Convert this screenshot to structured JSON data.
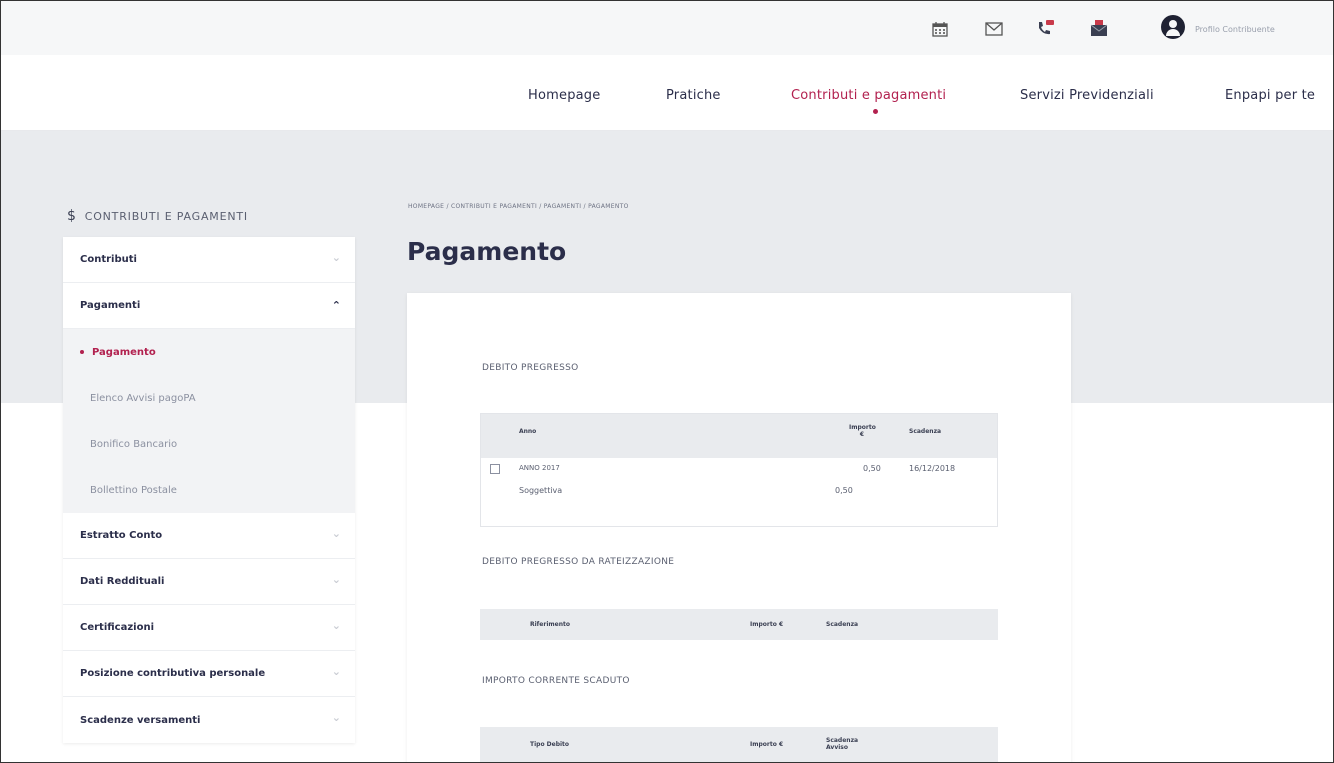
{
  "topbar": {
    "icons": [
      "calendar-icon",
      "mail-icon",
      "phone-icon",
      "inbox-icon"
    ],
    "user_name": "Profilo Contribuente"
  },
  "nav": {
    "items": [
      {
        "label": "Homepage"
      },
      {
        "label": "Pratiche"
      },
      {
        "label": "Contributi e pagamenti",
        "active": true
      },
      {
        "label": "Servizi Previdenziali"
      },
      {
        "label": "Enpapi per te"
      }
    ]
  },
  "sidebar": {
    "title": "CONTRIBUTI E PAGAMENTI",
    "items": [
      {
        "label": "Contributi"
      },
      {
        "label": "Pagamenti",
        "open": true
      },
      {
        "label": "Estratto Conto"
      },
      {
        "label": "Dati Reddituali"
      },
      {
        "label": "Certificazioni"
      },
      {
        "label": "Posizione contributiva personale"
      },
      {
        "label": "Scadenze versamenti"
      }
    ],
    "subitems": [
      {
        "label": "Pagamento",
        "active": true
      },
      {
        "label": "Elenco Avvisi pagoPA"
      },
      {
        "label": "Bonifico Bancario"
      },
      {
        "label": "Bollettino Postale"
      }
    ]
  },
  "breadcrumb": "HOMEPAGE / CONTRIBUTI E PAGAMENTI / PAGAMENTI / PAGAMENTO",
  "page_title": "Pagamento",
  "sections": {
    "debito": {
      "title": "DEBITO PREGRESSO",
      "headers": {
        "anno": "Anno",
        "importo": "Importo €",
        "scadenza": "Scadenza"
      },
      "row": {
        "anno": "ANNO 2017",
        "importo": "0,50",
        "scadenza": "16/12/2018"
      },
      "subrow": {
        "label": "Soggettiva",
        "importo": "0,50"
      }
    },
    "rateizzazione": {
      "title": "DEBITO PREGRESSO DA RATEIZZAZIONE",
      "headers": {
        "riferimento": "Riferimento",
        "importo": "Importo €",
        "scadenza": "Scadenza"
      }
    },
    "scaduto": {
      "title": "IMPORTO CORRENTE SCADUTO",
      "headers": {
        "tipo": "Tipo Debito",
        "importo": "Importo €",
        "scadenza": "Scadenza Avviso"
      }
    }
  },
  "colors": {
    "accent": "#b2214f",
    "text": "#2b2e4a",
    "band": "#e9ebee"
  }
}
